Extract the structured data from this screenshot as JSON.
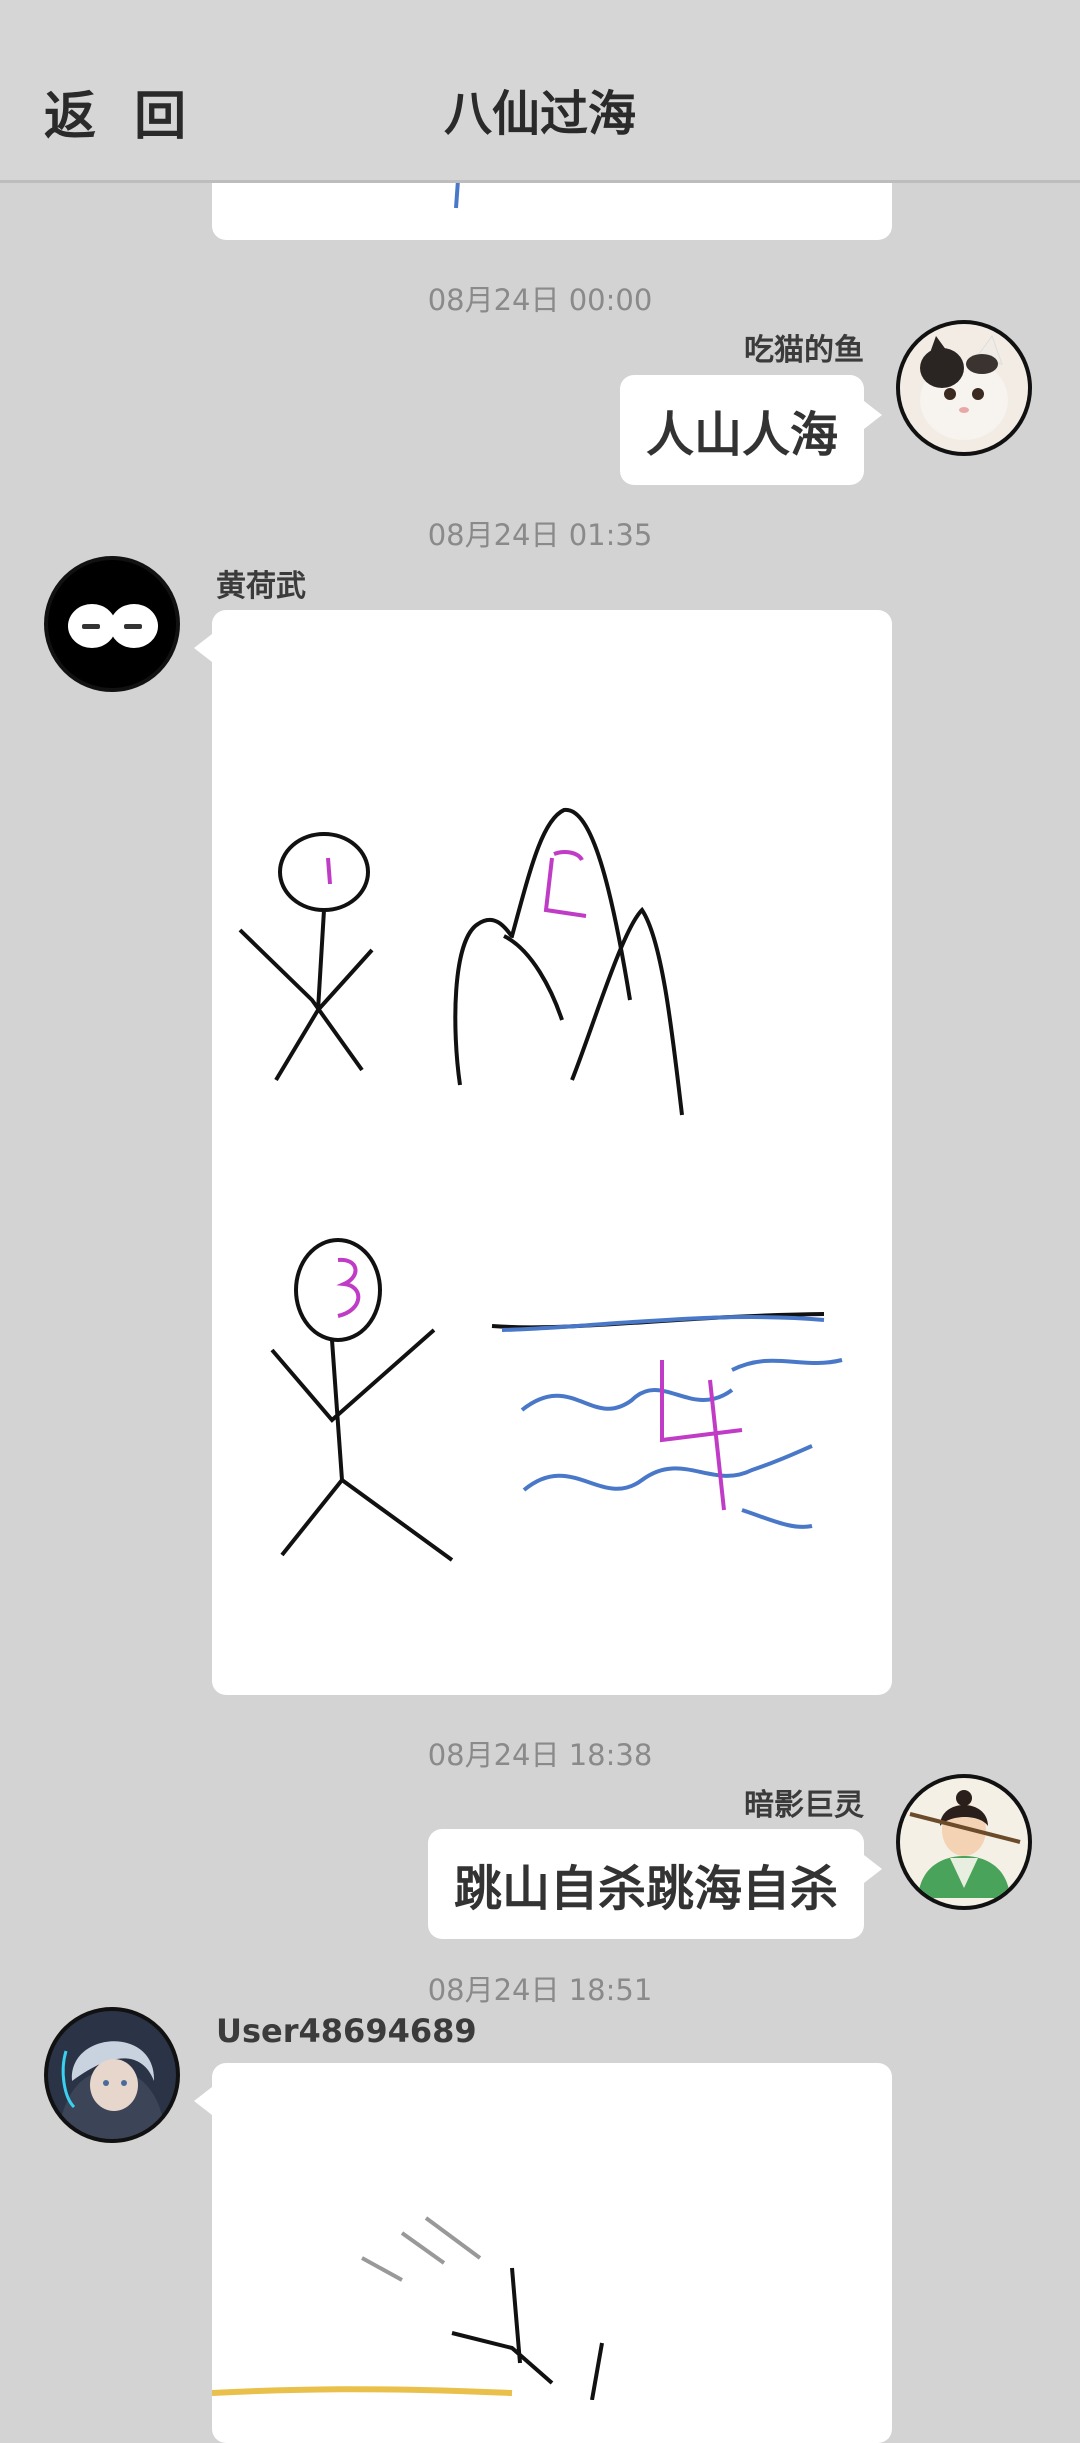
{
  "header": {
    "back_label": "返 回",
    "title": "八仙过海"
  },
  "messages": [
    {
      "time": "08月24日  00:00",
      "sender": "吃猫的鱼",
      "type": "text",
      "text": "人山人海",
      "avatar_icon": "cat-avatar-icon"
    },
    {
      "time": "08月24日  01:35",
      "sender": "黄荷武",
      "type": "drawing",
      "avatar_icon": "black-blob-avatar-icon",
      "drawing_labels": [
        "1",
        "2",
        "3",
        "4"
      ]
    },
    {
      "time": "08月24日  18:38",
      "sender": "暗影巨灵",
      "type": "text",
      "text": "跳山自杀跳海自杀",
      "avatar_icon": "swordsman-avatar-icon"
    },
    {
      "time": "08月24日  18:51",
      "sender": "User48694689",
      "type": "drawing",
      "avatar_icon": "silver-hair-avatar-icon"
    }
  ],
  "colors": {
    "background": "#d3d3d3",
    "bubble": "#ffffff",
    "ink": "#111111",
    "magenta": "#c03cc6",
    "blue": "#4a78c8",
    "yellow": "#e8c04a"
  }
}
